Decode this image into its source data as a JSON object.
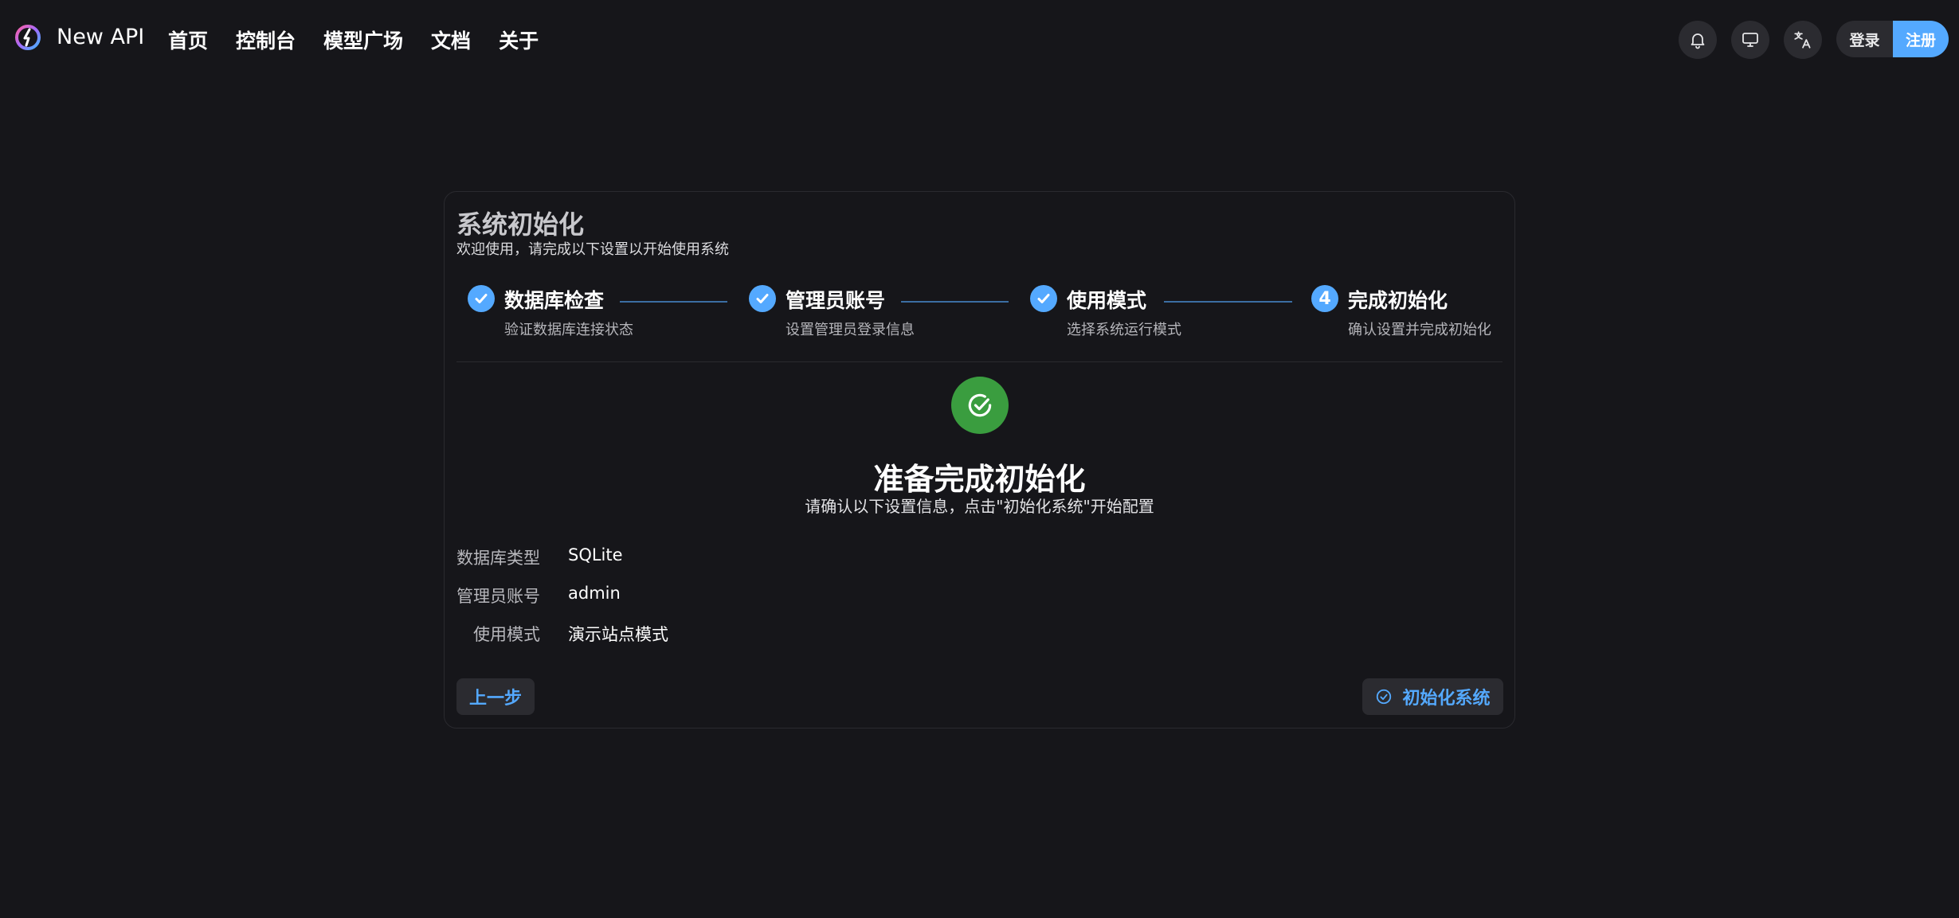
{
  "app": {
    "name": "New API"
  },
  "nav": {
    "links": [
      "首页",
      "控制台",
      "模型广场",
      "文档",
      "关于"
    ]
  },
  "header": {
    "icons": [
      "bell-icon",
      "monitor-icon",
      "translate-icon"
    ],
    "login_label": "登录",
    "register_label": "注册"
  },
  "setup": {
    "title": "系统初始化",
    "subtitle": "欢迎使用，请完成以下设置以开始使用系统",
    "steps": [
      {
        "title": "数据库检查",
        "desc": "验证数据库连接状态",
        "status": "done"
      },
      {
        "title": "管理员账号",
        "desc": "设置管理员登录信息",
        "status": "done"
      },
      {
        "title": "使用模式",
        "desc": "选择系统运行模式",
        "status": "done"
      },
      {
        "title": "完成初始化",
        "desc": "确认设置并完成初始化",
        "status": "current",
        "number": "4"
      }
    ],
    "ready_title": "准备完成初始化",
    "ready_subtitle": "请确认以下设置信息，点击\"初始化系统\"开始配置",
    "summary": [
      {
        "label": "数据库类型",
        "value": "SQLite"
      },
      {
        "label": "管理员账号",
        "value": "admin"
      },
      {
        "label": "使用模式",
        "value": "演示站点模式"
      }
    ],
    "prev_label": "上一步",
    "init_label": "初始化系统"
  },
  "colors": {
    "background": "#16161a",
    "accent": "#54a9ff",
    "success": "#3a9d3f",
    "surface": "#2b2b30"
  }
}
